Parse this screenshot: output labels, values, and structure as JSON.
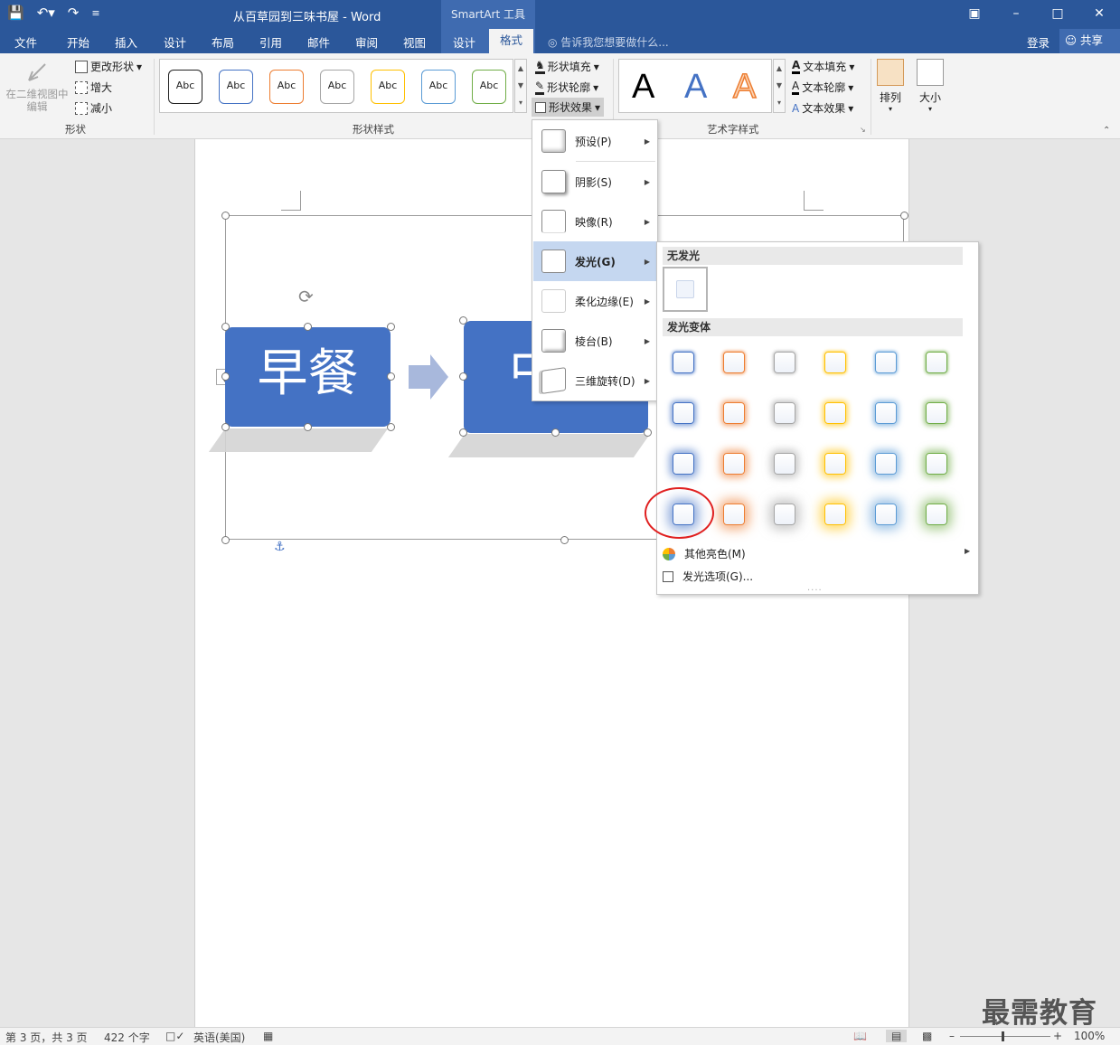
{
  "titlebar": {
    "document_title": "从百草园到三味书屋 - Word",
    "context_title": "SmartArt 工具"
  },
  "tabs": [
    "文件",
    "开始",
    "插入",
    "设计",
    "布局",
    "引用",
    "邮件",
    "审阅",
    "视图",
    "设计",
    "格式"
  ],
  "active_tab": "格式",
  "tell_me": "告诉我您想要做什么...",
  "login": "登录",
  "share": "共享",
  "ribbon": {
    "shapes_group": {
      "edit_in_2d": "在二维视图中编辑",
      "change_shape": "更改形状",
      "larger": "增大",
      "smaller": "减小",
      "label": "形状"
    },
    "shape_styles": {
      "label": "形状样式",
      "style_text": "Abc",
      "style_colors": [
        "#222222",
        "#4472c4",
        "#ed7d31",
        "#a5a5a5",
        "#ffc000",
        "#5b9bd5",
        "#70ad47"
      ],
      "fill": "形状填充",
      "outline": "形状轮廓",
      "effects": "形状效果"
    },
    "wordart": {
      "label": "艺术字样式",
      "letter": "A",
      "text_fill": "文本填充",
      "text_outline": "文本轮廓",
      "text_effects": "文本效果"
    },
    "arrange": "排列",
    "size": "大小"
  },
  "smartart": {
    "box1": "早餐",
    "box2": "中"
  },
  "effects_menu": [
    {
      "label": "预设(P)",
      "key": "P"
    },
    {
      "label": "阴影(S)",
      "key": "S"
    },
    {
      "label": "映像(R)",
      "key": "R"
    },
    {
      "label": "发光(G)",
      "key": "G",
      "highlighted": true
    },
    {
      "label": "柔化边缘(E)",
      "key": "E"
    },
    {
      "label": "棱台(B)",
      "key": "B"
    },
    {
      "label": "三维旋转(D)",
      "key": "D"
    }
  ],
  "glow_menu": {
    "no_glow": "无发光",
    "variations": "发光变体",
    "colors": [
      "#4472c4",
      "#ed7d31",
      "#a5a5a5",
      "#ffc000",
      "#5b9bd5",
      "#70ad47"
    ],
    "more_colors": "其他亮色(M)",
    "options": "发光选项(G)...",
    "selected_row": 4,
    "selected_col": 1
  },
  "status": {
    "page": "第 3 页，共 3 页",
    "words": "422 个字",
    "language": "英语(美国)",
    "zoom": "100%"
  },
  "watermark": "最需教育"
}
